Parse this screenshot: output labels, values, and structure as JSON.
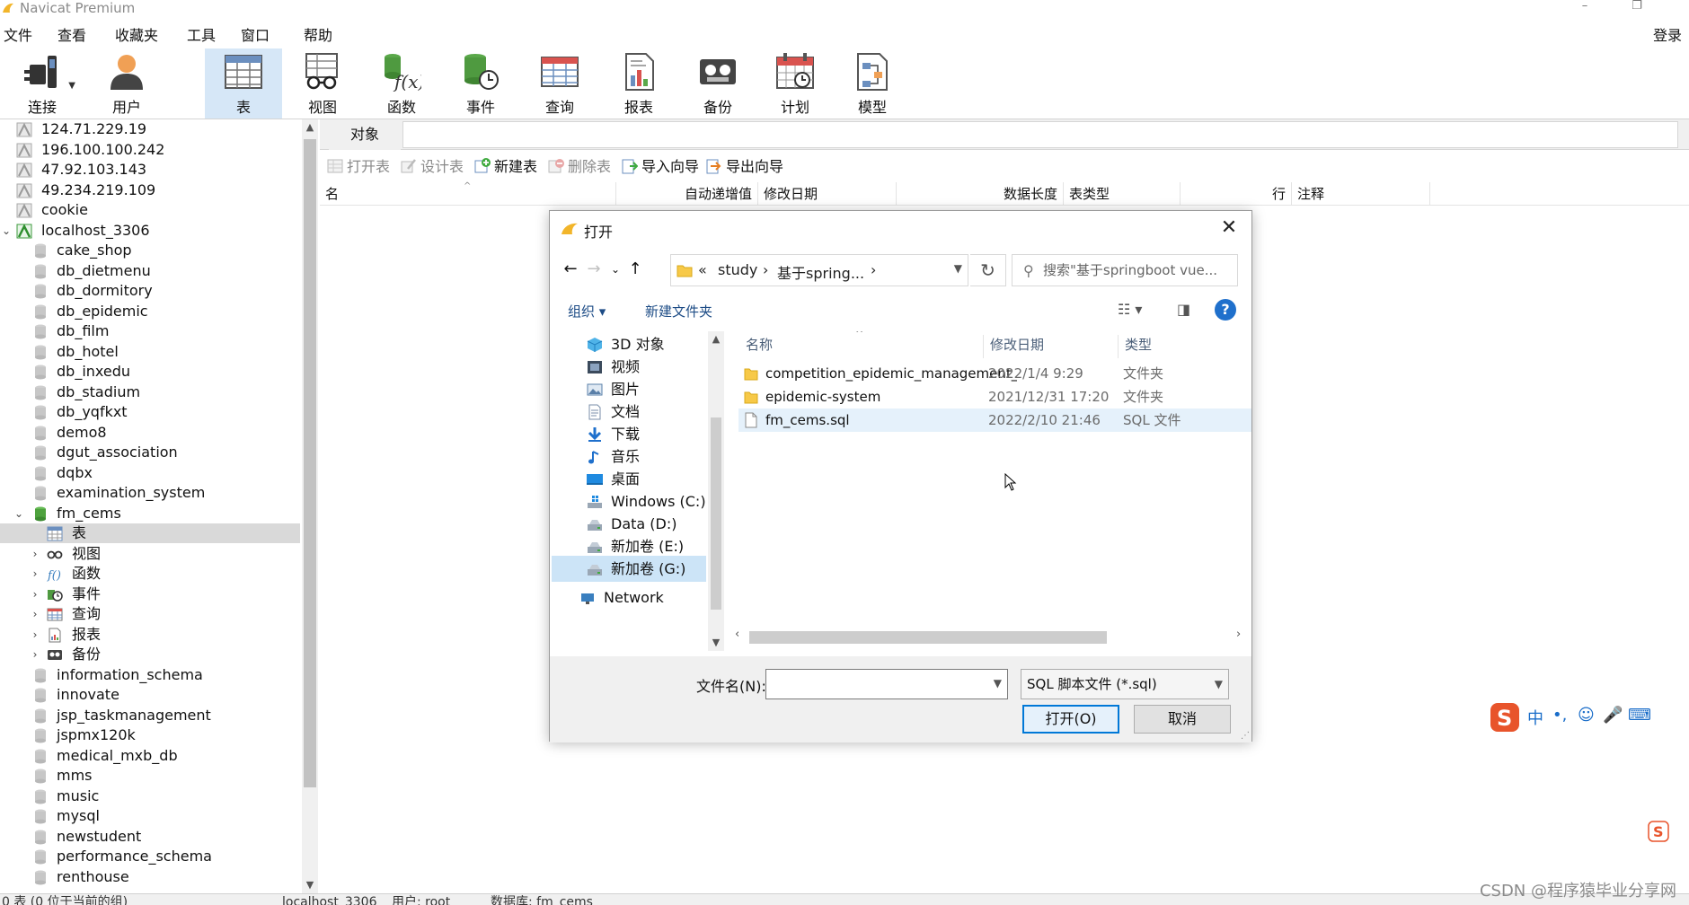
{
  "app": {
    "title": "Navicat Premium"
  },
  "menu": {
    "items": [
      "文件",
      "查看",
      "收藏夹",
      "工具",
      "窗口",
      "帮助"
    ],
    "login": "登录"
  },
  "toolbar": {
    "items": [
      {
        "label": "连接",
        "icon": "plug-icon"
      },
      {
        "label": "用户",
        "icon": "user-icon"
      },
      {
        "label": "表",
        "icon": "table-icon",
        "active": true
      },
      {
        "label": "视图",
        "icon": "view-glasses-icon"
      },
      {
        "label": "函数",
        "icon": "function-icon"
      },
      {
        "label": "事件",
        "icon": "event-clock-icon"
      },
      {
        "label": "查询",
        "icon": "query-icon"
      },
      {
        "label": "报表",
        "icon": "report-icon"
      },
      {
        "label": "备份",
        "icon": "backup-icon"
      },
      {
        "label": "计划",
        "icon": "schedule-icon"
      },
      {
        "label": "模型",
        "icon": "model-icon"
      }
    ]
  },
  "tree": {
    "items": [
      {
        "label": "124.71.229.19",
        "level": 0,
        "kind": "conn"
      },
      {
        "label": "196.100.100.242",
        "level": 0,
        "kind": "conn"
      },
      {
        "label": "47.92.103.143",
        "level": 0,
        "kind": "conn"
      },
      {
        "label": "49.234.219.109",
        "level": 0,
        "kind": "conn"
      },
      {
        "label": "cookie",
        "level": 0,
        "kind": "conn"
      },
      {
        "label": "localhost_3306",
        "level": 0,
        "kind": "conn-open",
        "expanded": true
      },
      {
        "label": "cake_shop",
        "level": 1,
        "kind": "db"
      },
      {
        "label": "db_dietmenu",
        "level": 1,
        "kind": "db"
      },
      {
        "label": "db_dormitory",
        "level": 1,
        "kind": "db"
      },
      {
        "label": "db_epidemic",
        "level": 1,
        "kind": "db"
      },
      {
        "label": "db_film",
        "level": 1,
        "kind": "db"
      },
      {
        "label": "db_hotel",
        "level": 1,
        "kind": "db"
      },
      {
        "label": "db_inxedu",
        "level": 1,
        "kind": "db"
      },
      {
        "label": "db_stadium",
        "level": 1,
        "kind": "db"
      },
      {
        "label": "db_yqfkxt",
        "level": 1,
        "kind": "db"
      },
      {
        "label": "demo8",
        "level": 1,
        "kind": "db"
      },
      {
        "label": "dgut_association",
        "level": 1,
        "kind": "db"
      },
      {
        "label": "dqbx",
        "level": 1,
        "kind": "db"
      },
      {
        "label": "examination_system",
        "level": 1,
        "kind": "db"
      },
      {
        "label": "fm_cems",
        "level": 1,
        "kind": "db-open",
        "expanded": true
      },
      {
        "label": "表",
        "level": 2,
        "kind": "tables",
        "selected": true
      },
      {
        "label": "视图",
        "level": 2,
        "kind": "views",
        "collapsed": true
      },
      {
        "label": "函数",
        "level": 2,
        "kind": "functions",
        "collapsed": true
      },
      {
        "label": "事件",
        "level": 2,
        "kind": "events",
        "collapsed": true
      },
      {
        "label": "查询",
        "level": 2,
        "kind": "queries",
        "collapsed": true
      },
      {
        "label": "报表",
        "level": 2,
        "kind": "reports",
        "collapsed": true
      },
      {
        "label": "备份",
        "level": 2,
        "kind": "backups",
        "collapsed": true
      },
      {
        "label": "information_schema",
        "level": 1,
        "kind": "db"
      },
      {
        "label": "innovate",
        "level": 1,
        "kind": "db"
      },
      {
        "label": "jsp_taskmanagement",
        "level": 1,
        "kind": "db"
      },
      {
        "label": "jspmx120k",
        "level": 1,
        "kind": "db"
      },
      {
        "label": "medical_mxb_db",
        "level": 1,
        "kind": "db"
      },
      {
        "label": "mms",
        "level": 1,
        "kind": "db"
      },
      {
        "label": "music",
        "level": 1,
        "kind": "db"
      },
      {
        "label": "mysql",
        "level": 1,
        "kind": "db"
      },
      {
        "label": "newstudent",
        "level": 1,
        "kind": "db"
      },
      {
        "label": "performance_schema",
        "level": 1,
        "kind": "db"
      },
      {
        "label": "renthouse",
        "level": 1,
        "kind": "db"
      }
    ]
  },
  "main": {
    "tab": "对象",
    "actions": [
      {
        "label": "打开表",
        "disabled": true,
        "icon": "open-table-icon"
      },
      {
        "label": "设计表",
        "disabled": true,
        "icon": "design-table-icon"
      },
      {
        "label": "新建表",
        "disabled": false,
        "icon": "new-table-icon"
      },
      {
        "label": "删除表",
        "disabled": true,
        "icon": "delete-table-icon"
      },
      {
        "label": "导入向导",
        "disabled": false,
        "icon": "import-wizard-icon"
      },
      {
        "label": "导出向导",
        "disabled": false,
        "icon": "export-wizard-icon"
      }
    ],
    "columns": [
      "名",
      "自动递增值",
      "修改日期",
      "数据长度",
      "表类型",
      "行",
      "注释"
    ]
  },
  "dialog": {
    "title": "打开",
    "address": {
      "prefix": "«",
      "segments": [
        "study",
        "基于spring..."
      ]
    },
    "search_placeholder": "搜索\"基于springboot vue...",
    "organize": "组织 ▾",
    "new_folder": "新建文件夹",
    "nav": [
      {
        "label": "3D 对象",
        "icon": "3d-objects-icon"
      },
      {
        "label": "视频",
        "icon": "videos-icon"
      },
      {
        "label": "图片",
        "icon": "pictures-icon"
      },
      {
        "label": "文档",
        "icon": "documents-icon"
      },
      {
        "label": "下载",
        "icon": "downloads-icon"
      },
      {
        "label": "音乐",
        "icon": "music-icon"
      },
      {
        "label": "桌面",
        "icon": "desktop-icon"
      },
      {
        "label": "Windows (C:)",
        "icon": "drive-icon"
      },
      {
        "label": "Data (D:)",
        "icon": "drive-icon"
      },
      {
        "label": "新加卷 (E:)",
        "icon": "drive-icon"
      },
      {
        "label": "新加卷 (G:)",
        "icon": "drive-icon",
        "selected": true
      },
      {
        "label": "Network",
        "icon": "network-icon"
      }
    ],
    "list_headers": {
      "name": "名称",
      "date": "修改日期",
      "type": "类型"
    },
    "files": [
      {
        "name": "competition_epidemic_management_...",
        "date": "2022/1/4 9:29",
        "type": "文件夹",
        "kind": "folder"
      },
      {
        "name": "epidemic-system",
        "date": "2021/12/31 17:20",
        "type": "文件夹",
        "kind": "folder"
      },
      {
        "name": "fm_cems.sql",
        "date": "2022/2/10 21:46",
        "type": "SQL 文件",
        "kind": "file",
        "hover": true
      }
    ],
    "filename_label": "文件名(N):",
    "filename_value": "",
    "filter": "SQL 脚本文件 (*.sql)",
    "open_label": "打开(O)",
    "cancel_label": "取消"
  },
  "status": {
    "left": "0 表 (0 位于当前的组)",
    "conn": "localhost_3306",
    "user": "用户: root",
    "db": "数据库: fm_cems"
  },
  "watermark": "CSDN @程序猿毕业分享网",
  "ime": {
    "items": [
      "中",
      "•,",
      "☺",
      "🎤",
      "⌨"
    ]
  }
}
